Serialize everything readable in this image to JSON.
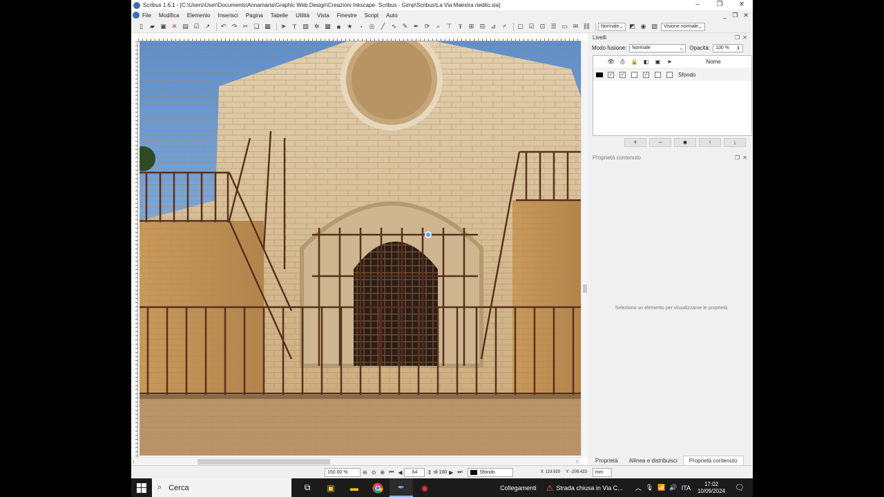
{
  "window": {
    "title": "Scribus 1.6.1 - [C:\\Users\\User\\Documents\\Annamaria\\Graphic Web Design\\Creazioni Inkscape- Scribus - Gimp\\Scribus\\La Via Maestra riedito.sla]",
    "controls": [
      "–",
      "❐",
      "✕"
    ]
  },
  "menu": [
    "File",
    "Modifica",
    "Elemento",
    "Inserisci",
    "Pagina",
    "Tabelle",
    "Utilità",
    "Vista",
    "Finestre",
    "Script",
    "Auto"
  ],
  "toolbar": {
    "mode_select": "Normale",
    "view_select": "Visione normale"
  },
  "layers_panel": {
    "title": "Livelli",
    "blend_label": "Modo fusione:",
    "blend_value": "Normale",
    "opacity_label": "Opacità:",
    "opacity_value": "100 %",
    "col_name": "Nome",
    "layer_name": "Sfondo",
    "btn_add": "+",
    "btn_remove": "−",
    "btn_dup": "■",
    "btn_up": "↑",
    "btn_down": "↓"
  },
  "content_props": {
    "title": "Proprietà contenuto",
    "empty_msg": "Seleziona un elemento per visualizzarne le proprietà"
  },
  "panel_tabs": [
    "Proprietà",
    "Allinea e distribuisci",
    "Proprietà contenuto"
  ],
  "status": {
    "zoom": "150.00 %",
    "page": "64",
    "page_of": "di 100",
    "layer": "Sfondo",
    "x_coord": "X: 119.920",
    "y_coord": "Y: -209.423",
    "unit": "mm"
  },
  "taskbar": {
    "search": "Cerca",
    "links": "Collegamenti",
    "notification": "Strada chiusa in Via C...",
    "lang": "ITA",
    "time": "17:02",
    "date": "10/09/2024"
  }
}
